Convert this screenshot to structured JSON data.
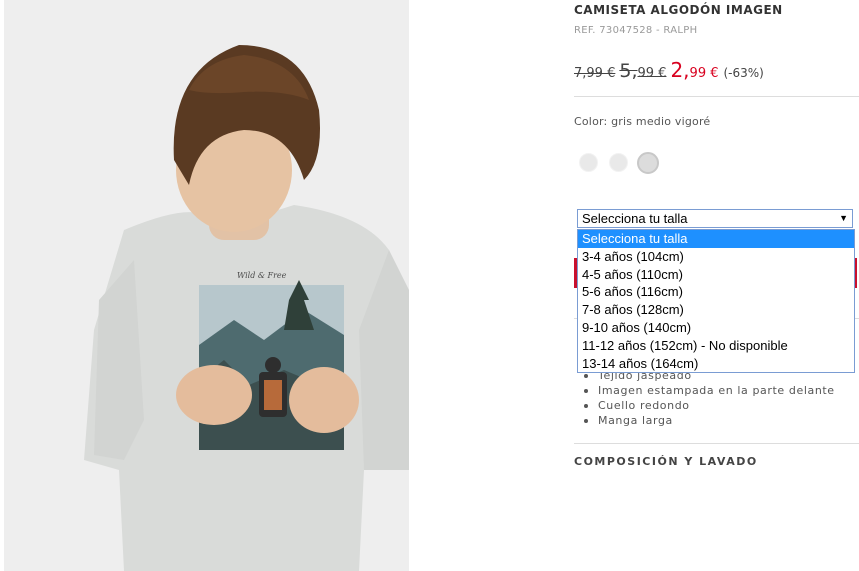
{
  "product": {
    "title": "CAMISETA ALGODÓN IMAGEN",
    "reference": "REF. 73047528 - RALPH",
    "price_original": "7,99 €",
    "price_previous_main": "5,",
    "price_previous_rest": "99 €",
    "price_current_main": "2,",
    "price_current_rest": "99 €",
    "discount": "(-63%)",
    "color_label": "Color: gris medio vigoré",
    "image_print_text": "Wild & Free"
  },
  "size_select": {
    "selected": "Selecciona tu talla",
    "options": [
      "Selecciona tu talla",
      "3-4 años (104cm)",
      "4-5 años (110cm)",
      "5-6 años (116cm)",
      "7-8 años (128cm)",
      "9-10 años (140cm)",
      "11-12 años (152cm) - No disponible",
      "13-14 años (164cm)"
    ]
  },
  "features": [
    "Tejido jaspeado",
    "Imagen estampada en la parte delante",
    "Cuello redondo",
    "Manga larga"
  ],
  "composition_heading": "COMPOSICIÓN Y LAVADO",
  "colors": {
    "accent_red": "#d8001f",
    "select_highlight": "#1e90ff",
    "image_background": "#eeeeee"
  }
}
